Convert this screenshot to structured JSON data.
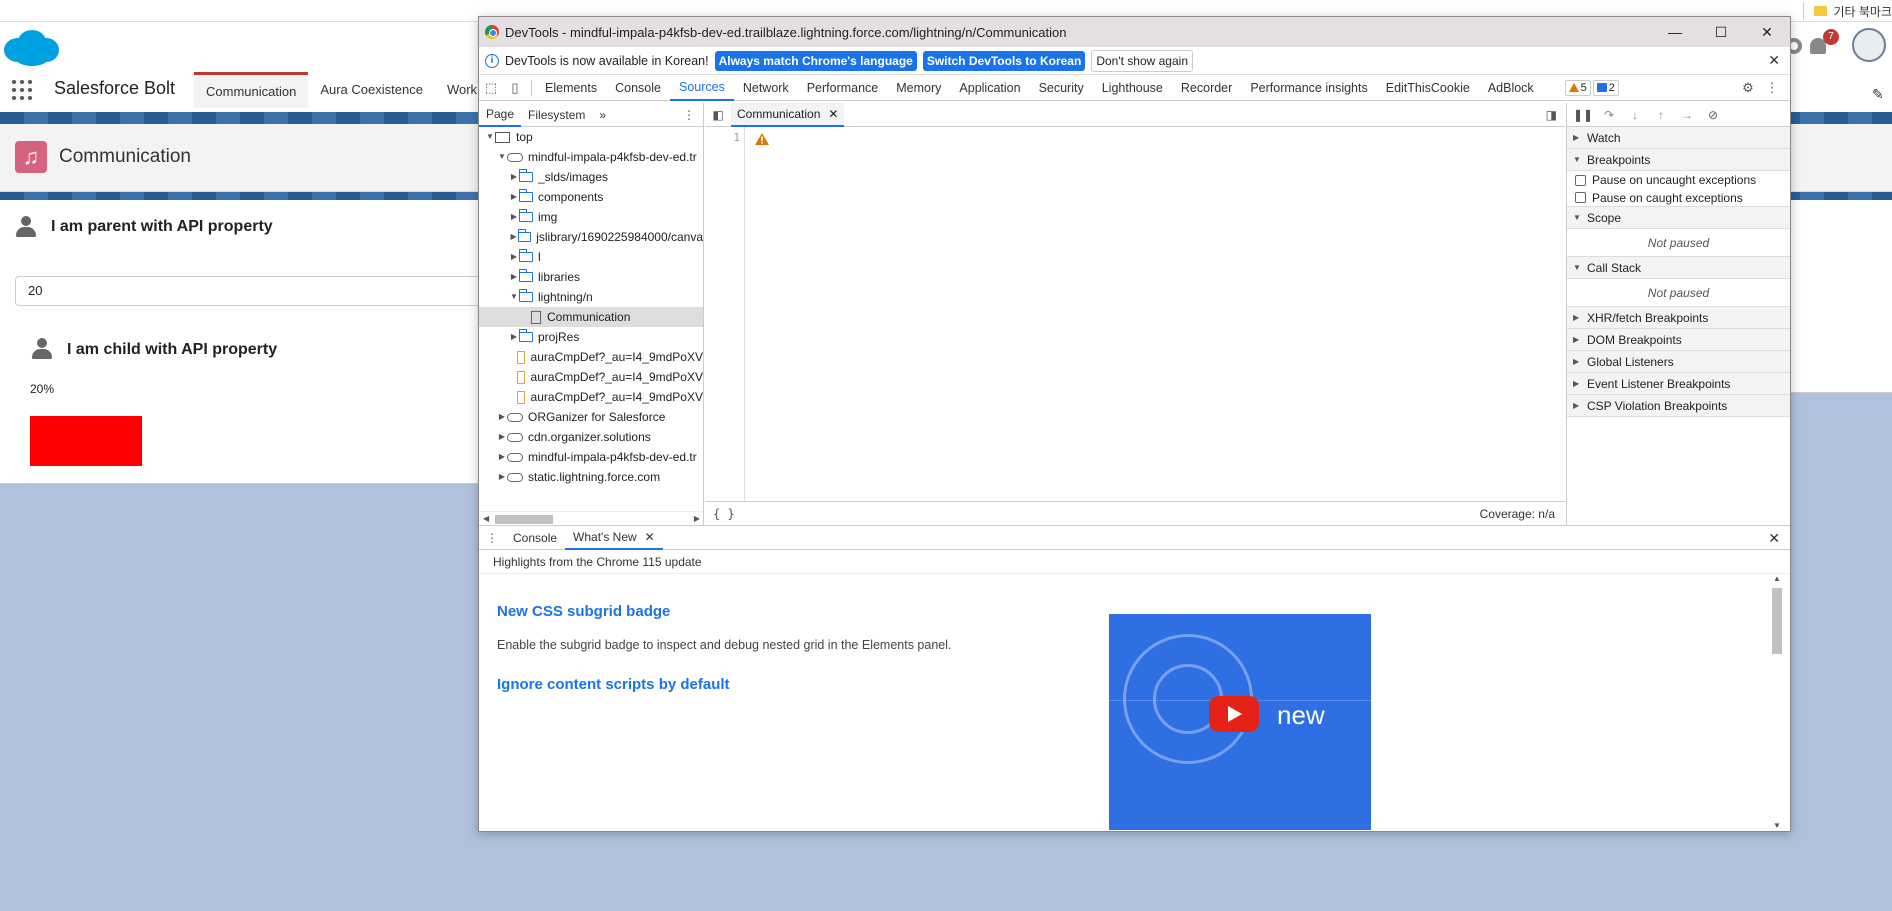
{
  "browser": {
    "bookmark_label": "기타 북마크"
  },
  "salesforce": {
    "app_name": "Salesforce Bolt",
    "tabs": [
      {
        "label": "Communication",
        "active": true
      },
      {
        "label": "Aura Coexistence",
        "active": false
      },
      {
        "label": "Work",
        "active": false
      }
    ],
    "page_title": "Communication",
    "notification_count": "7",
    "parent_card": {
      "title": "I am parent with API property",
      "input_value": "20"
    },
    "child_card": {
      "title": "I am child with API property",
      "percent_label": "20%",
      "progress_fraction": 0.2
    },
    "colors": {
      "stripe": "#2a5c94",
      "progress": "#ff0000",
      "page_icon": "#d6637e",
      "active_tab": "#c23934"
    }
  },
  "devtools": {
    "title": "DevTools - mindful-impala-p4kfsb-dev-ed.trailblaze.lightning.force.com/lightning/n/Communication",
    "infobar": {
      "message": "DevTools is now available in Korean!",
      "match_button": "Always match Chrome's language",
      "switch_button": "Switch DevTools to Korean",
      "dismiss_button": "Don't show again"
    },
    "tabs": [
      {
        "label": "Elements",
        "active": false
      },
      {
        "label": "Console",
        "active": false
      },
      {
        "label": "Sources",
        "active": true
      },
      {
        "label": "Network",
        "active": false
      },
      {
        "label": "Performance",
        "active": false
      },
      {
        "label": "Memory",
        "active": false
      },
      {
        "label": "Application",
        "active": false
      },
      {
        "label": "Security",
        "active": false
      },
      {
        "label": "Lighthouse",
        "active": false
      },
      {
        "label": "Recorder",
        "active": false
      },
      {
        "label": "Performance insights",
        "active": false
      },
      {
        "label": "EditThisCookie",
        "active": false
      },
      {
        "label": "AdBlock",
        "active": false
      }
    ],
    "warning_count": "5",
    "message_count": "2",
    "navigator": {
      "tabs": [
        "Page",
        "Filesystem"
      ],
      "tree": [
        {
          "label": "top",
          "kind": "frame",
          "depth": 0,
          "expanded": true
        },
        {
          "label": "mindful-impala-p4kfsb-dev-ed.tr",
          "kind": "cloud",
          "depth": 1,
          "expanded": true
        },
        {
          "label": "_slds/images",
          "kind": "folder",
          "depth": 2,
          "expanded": false
        },
        {
          "label": "components",
          "kind": "folder",
          "depth": 2,
          "expanded": false
        },
        {
          "label": "img",
          "kind": "folder",
          "depth": 2,
          "expanded": false
        },
        {
          "label": "jslibrary/1690225984000/canva",
          "kind": "folder",
          "depth": 2,
          "expanded": false
        },
        {
          "label": "l",
          "kind": "folder",
          "depth": 2,
          "expanded": false
        },
        {
          "label": "libraries",
          "kind": "folder",
          "depth": 2,
          "expanded": false
        },
        {
          "label": "lightning/n",
          "kind": "folder",
          "depth": 2,
          "expanded": true
        },
        {
          "label": "Communication",
          "kind": "file",
          "depth": 3,
          "selected": true
        },
        {
          "label": "projRes",
          "kind": "folder",
          "depth": 2,
          "expanded": false
        },
        {
          "label": "auraCmpDef?_au=I4_9mdPoXV",
          "kind": "file-orange",
          "depth": 2
        },
        {
          "label": "auraCmpDef?_au=I4_9mdPoXV",
          "kind": "file-orange",
          "depth": 2
        },
        {
          "label": "auraCmpDef?_au=I4_9mdPoXV",
          "kind": "file-orange",
          "depth": 2
        },
        {
          "label": "ORGanizer for Salesforce",
          "kind": "cloud",
          "depth": 1,
          "expanded": false
        },
        {
          "label": "cdn.organizer.solutions",
          "kind": "cloud",
          "depth": 1,
          "expanded": false
        },
        {
          "label": "mindful-impala-p4kfsb-dev-ed.tr",
          "kind": "cloud",
          "depth": 1,
          "expanded": false
        },
        {
          "label": "static.lightning.force.com",
          "kind": "cloud",
          "depth": 1,
          "expanded": false
        }
      ]
    },
    "editor": {
      "open_tab": "Communication",
      "line_number": "1",
      "coverage": "Coverage: n/a"
    },
    "debugger": {
      "sections": {
        "watch": "Watch",
        "breakpoints": "Breakpoints",
        "pause_uncaught": "Pause on uncaught exceptions",
        "pause_caught": "Pause on caught exceptions",
        "scope": "Scope",
        "scope_status": "Not paused",
        "call_stack": "Call Stack",
        "call_stack_status": "Not paused",
        "xhr": "XHR/fetch Breakpoints",
        "dom": "DOM Breakpoints",
        "global": "Global Listeners",
        "event": "Event Listener Breakpoints",
        "csp": "CSP Violation Breakpoints"
      }
    },
    "drawer": {
      "tabs": [
        {
          "label": "Console",
          "active": false
        },
        {
          "label": "What's New",
          "active": true
        }
      ],
      "subtitle": "Highlights from the Chrome 115 update",
      "items": [
        {
          "title": "New CSS subgrid badge",
          "description": "Enable the subgrid badge to inspect and debug nested grid in the Elements panel."
        },
        {
          "title": "Ignore content scripts by default",
          "description": ""
        }
      ],
      "video_label": "new"
    }
  }
}
